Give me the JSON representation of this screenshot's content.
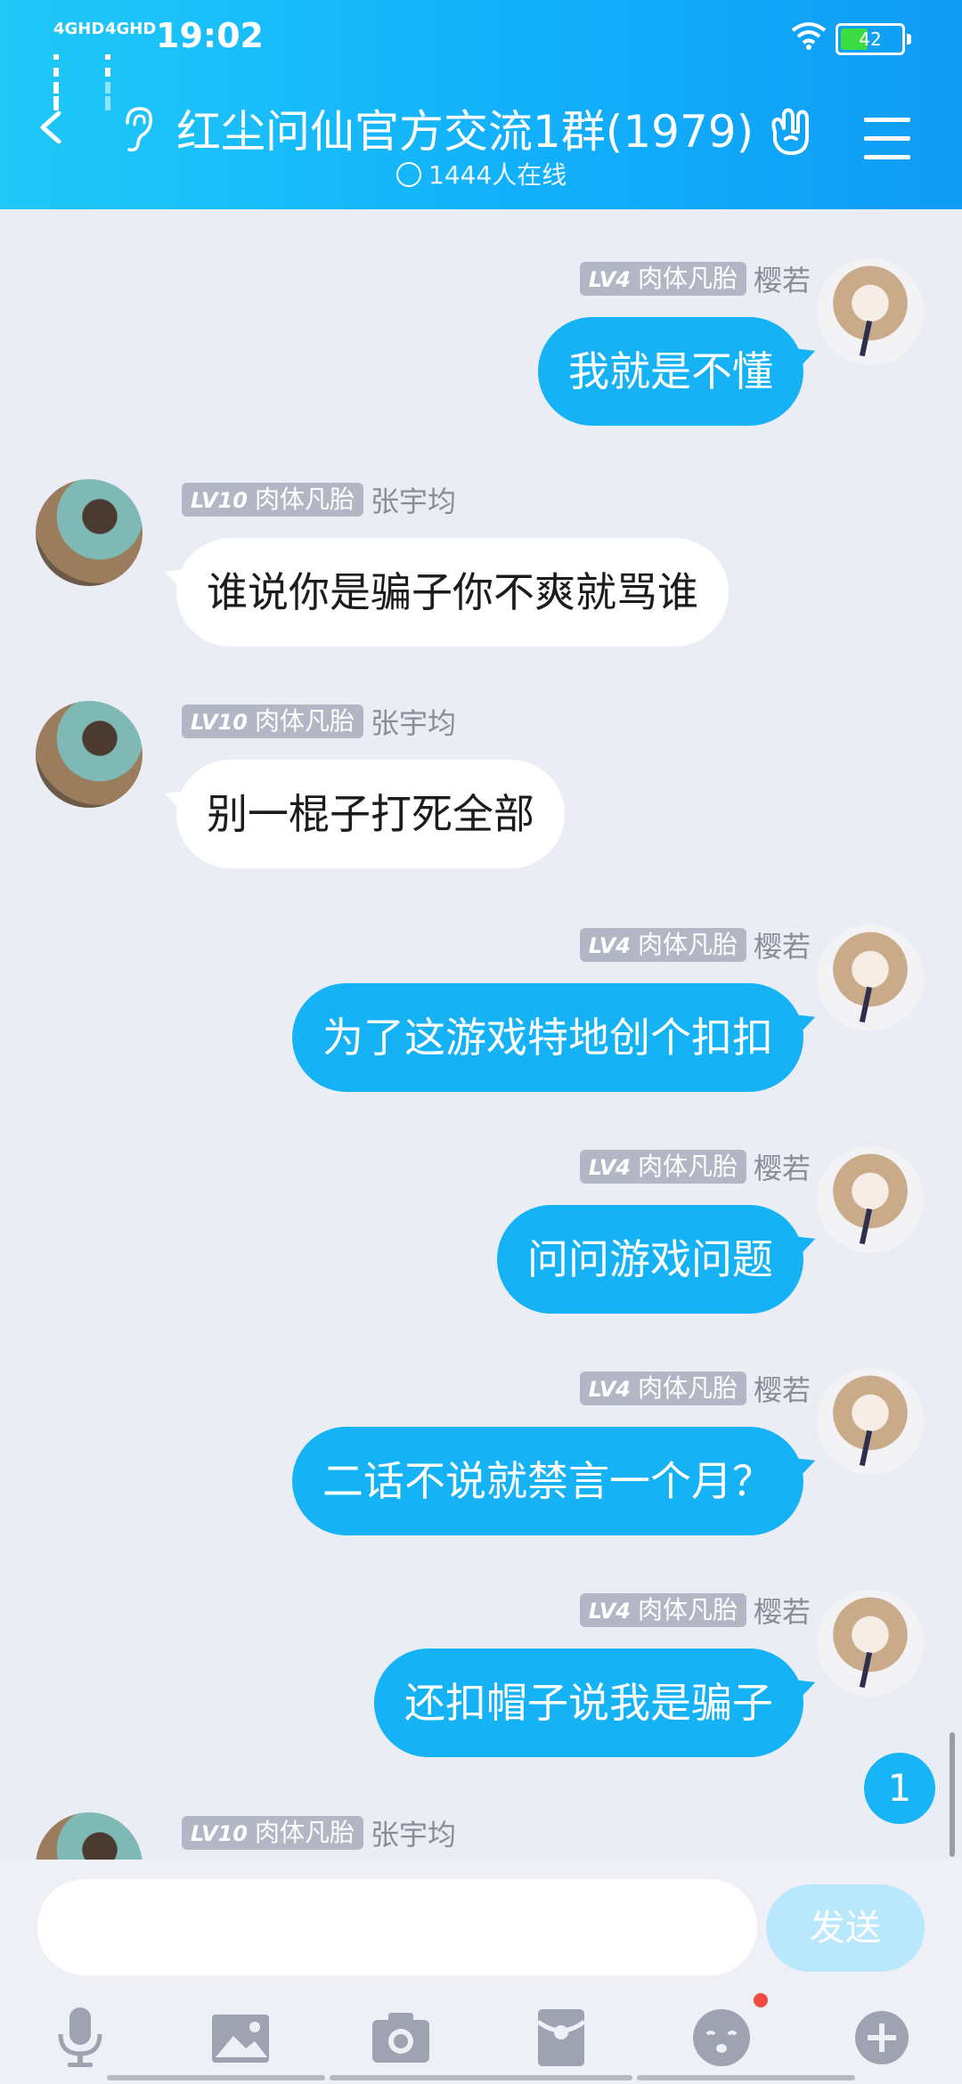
{
  "status_bar": {
    "net1": "4GHD",
    "net2": "4GHD",
    "time": "19:02",
    "battery": "42"
  },
  "header": {
    "title": "红尘问仙官方交流1群(1979)",
    "online": "1444人在线"
  },
  "messages": [
    {
      "side": "out",
      "level": "LV4",
      "rank": "肉体凡胎",
      "name": "樱若",
      "text": "我就是不懂"
    },
    {
      "side": "in",
      "level": "LV10",
      "rank": "肉体凡胎",
      "name": "张宇均",
      "text": "谁说你是骗子你不爽就骂谁"
    },
    {
      "side": "in",
      "level": "LV10",
      "rank": "肉体凡胎",
      "name": "张宇均",
      "text": "别一棍子打死全部"
    },
    {
      "side": "out",
      "level": "LV4",
      "rank": "肉体凡胎",
      "name": "樱若",
      "text": "为了这游戏特地创个扣扣"
    },
    {
      "side": "out",
      "level": "LV4",
      "rank": "肉体凡胎",
      "name": "樱若",
      "text": "问问游戏问题"
    },
    {
      "side": "out",
      "level": "LV4",
      "rank": "肉体凡胎",
      "name": "樱若",
      "text": "二话不说就禁言一个月？"
    },
    {
      "side": "out",
      "level": "LV4",
      "rank": "肉体凡胎",
      "name": "樱若",
      "text": "还扣帽子说我是骗子"
    },
    {
      "side": "in",
      "level": "LV10",
      "rank": "肉体凡胎",
      "name": "张宇均",
      "text": ""
    }
  ],
  "unread_count": "1",
  "input": {
    "send_label": "发送",
    "placeholder": ""
  },
  "toolbar_icons": [
    "microphone-icon",
    "image-icon",
    "camera-icon",
    "red-packet-icon",
    "emoji-icon",
    "plus-icon"
  ],
  "colors": {
    "header": "#12b0fb",
    "bubble_out": "#15b2f5",
    "bubble_in": "#ffffff",
    "background": "#eaedf4"
  }
}
